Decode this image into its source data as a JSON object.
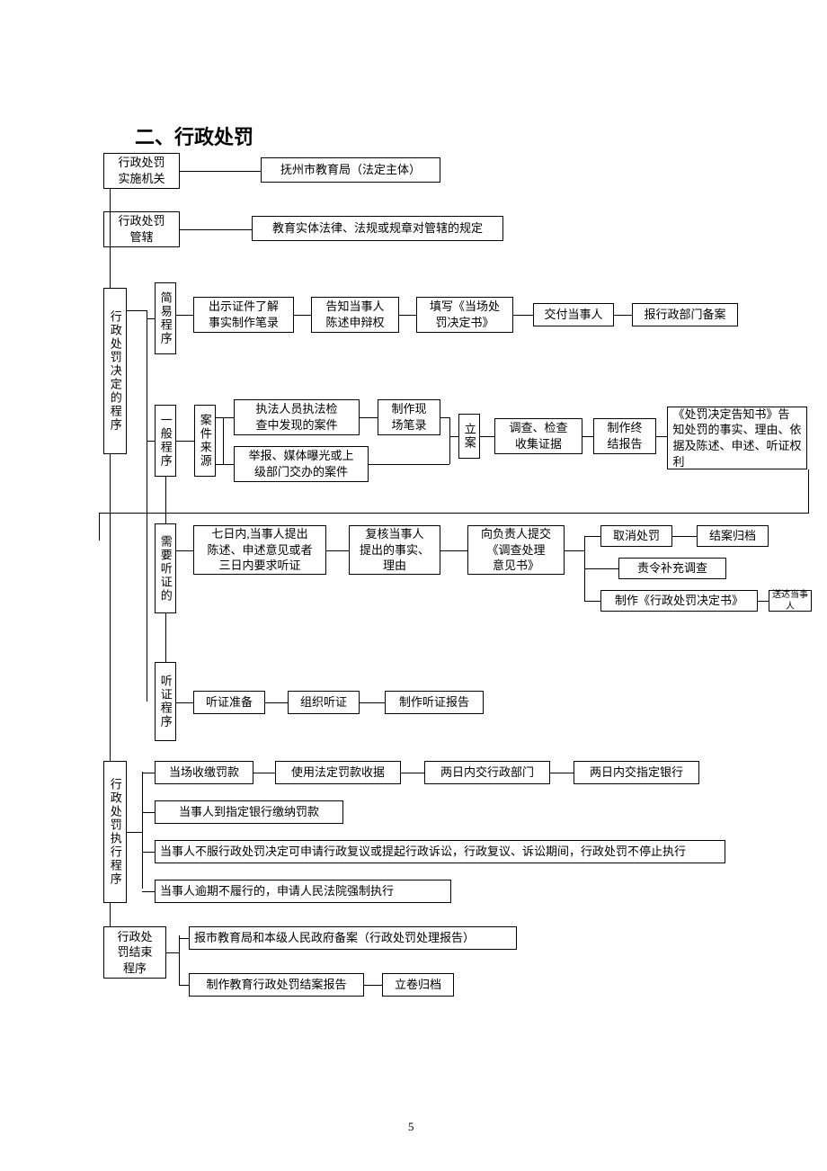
{
  "title": "二、行政处罚",
  "pagenum": "5",
  "n1": {
    "label": "行政处罚\n实施机关",
    "r1": "抚州市教育局（法定主体）"
  },
  "n2": {
    "label": "行政处罚\n管辖",
    "r1": "教育实体法律、法规或规章对管辖的规定"
  },
  "n3": {
    "label": "行政处罚决定的程序"
  },
  "simp": {
    "label": "简易程序",
    "s1": "出示证件了解\n事实制作笔录",
    "s2": "告知当事人\n陈述申辩权",
    "s3": "填写《当场处\n罚决定书》",
    "s4": "交付当事人",
    "s5": "报行政部门备案"
  },
  "gen": {
    "label": "一般程序",
    "src": "案件来源",
    "a1": "执法人员执法检\n查中发现的案件",
    "a2": "举报、媒体曝光或上\n级部门交办的案件",
    "b1": "制作现\n场笔录",
    "b2": "立案",
    "b3": "调查、检查\n收集证据",
    "b4": "制作终\n结报告",
    "b5": "《处罚决定告知书》告\n知处罚的事实、理由、依\n据及陈述、申述、听证权\n利"
  },
  "hear": {
    "label": "需要听证的",
    "h1": "七日内,当事人提出\n陈述、申述意见或者\n三日内要求听证",
    "h2": "复核当事人\n提出的事实、\n理由",
    "h3": "向负责人提交\n《调查处理\n意见书》",
    "h4a": "取消处罚",
    "h4b": "结案归档",
    "h5": "责令补充调查",
    "h6": "制作《行政处罚决定书》",
    "h7": "送达当事人"
  },
  "proc": {
    "label": "听证程序",
    "p1": "听证准备",
    "p2": "组织听证",
    "p3": "制作听证报告"
  },
  "exec": {
    "label": "行政处罚执行程序",
    "e1": "当场收缴罚款",
    "e2": "使用法定罚款收据",
    "e3": "两日内交行政部门",
    "e4": "两日内交指定银行",
    "f1": "当事人到指定银行缴纳罚款",
    "f2": "当事人不服行政处罚决定可申请行政复议或提起行政诉讼，行政复议、诉讼期间，行政处罚不停止执行",
    "f3": "当事人逾期不履行的，申请人民法院强制执行"
  },
  "end": {
    "label": "行政处\n罚结束\n程序",
    "g1": "报市教育局和本级人民政府备案（行政处罚处理报告）",
    "g2": "制作教育行政处罚结案报告",
    "g3": "立卷归档"
  }
}
